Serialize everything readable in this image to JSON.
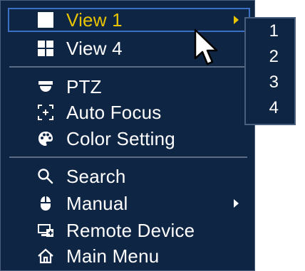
{
  "menu": {
    "items": [
      {
        "label": "View 1",
        "icon": "single-view-icon",
        "selected": true,
        "submenu": true
      },
      {
        "label": "View 4",
        "icon": "quad-view-icon",
        "selected": false,
        "submenu": false
      },
      {
        "label": "PTZ",
        "icon": "ptz-camera-icon",
        "selected": false,
        "submenu": false
      },
      {
        "label": "Auto Focus",
        "icon": "focus-icon",
        "selected": false,
        "submenu": false
      },
      {
        "label": "Color Setting",
        "icon": "palette-icon",
        "selected": false,
        "submenu": false
      },
      {
        "label": "Search",
        "icon": "search-icon",
        "selected": false,
        "submenu": false
      },
      {
        "label": "Manual",
        "icon": "mouse-icon",
        "selected": false,
        "submenu": true
      },
      {
        "label": "Remote Device",
        "icon": "remote-device-icon",
        "selected": false,
        "submenu": false
      },
      {
        "label": "Main Menu",
        "icon": "home-icon",
        "selected": false,
        "submenu": false
      }
    ]
  },
  "submenu": {
    "items": [
      "1",
      "2",
      "3",
      "4"
    ]
  },
  "colors": {
    "menu_background": "#0f2544",
    "menu_border": "#4a5f80",
    "selected_text": "#e8c400",
    "selected_border": "#3c6fc6",
    "text": "#ffffff",
    "separator": "#5b6b86"
  }
}
